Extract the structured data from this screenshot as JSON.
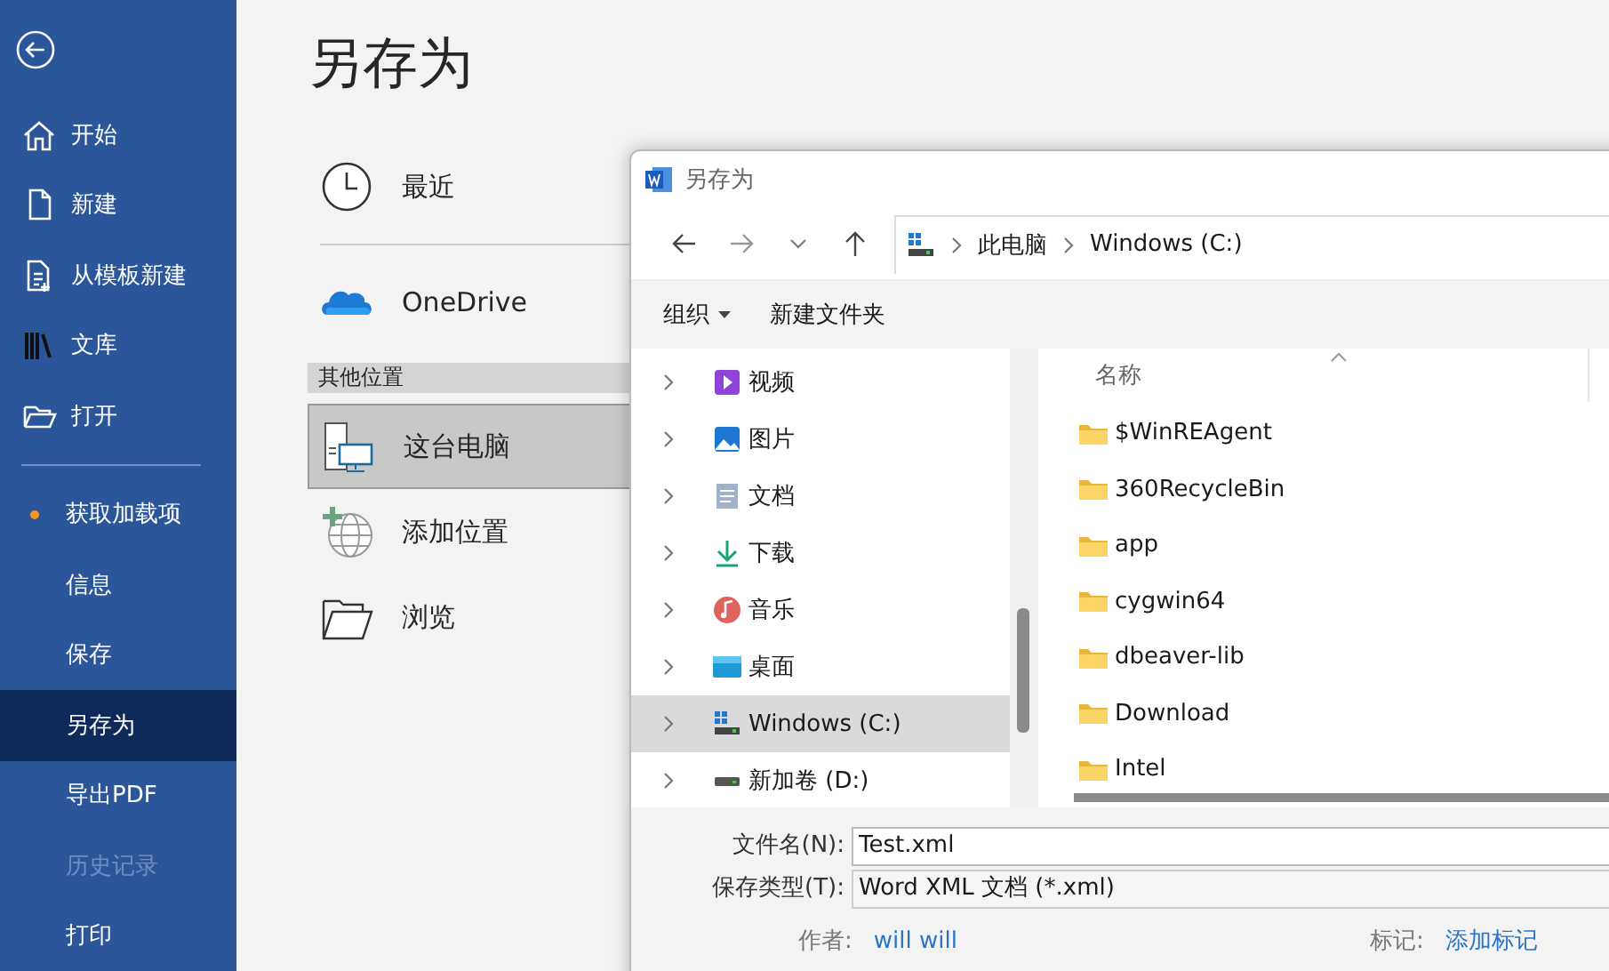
{
  "sidebar": {
    "primary": [
      {
        "label": "开始",
        "kind": "home"
      },
      {
        "label": "新建",
        "kind": "file"
      },
      {
        "label": "从模板新建",
        "kind": "template"
      },
      {
        "label": "文库",
        "kind": "library"
      },
      {
        "label": "打开",
        "kind": "folder"
      }
    ],
    "secondary": [
      {
        "label": "获取加载项",
        "selected": false,
        "disabled": false,
        "badge": true
      },
      {
        "label": "信息",
        "selected": false,
        "disabled": false,
        "badge": false
      },
      {
        "label": "保存",
        "selected": false,
        "disabled": false,
        "badge": false
      },
      {
        "label": "另存为",
        "selected": true,
        "disabled": false,
        "badge": false
      },
      {
        "label": "导出PDF",
        "selected": false,
        "disabled": false,
        "badge": false
      },
      {
        "label": "历史记录",
        "selected": false,
        "disabled": true,
        "badge": false
      },
      {
        "label": "打印",
        "selected": false,
        "disabled": false,
        "badge": false
      }
    ]
  },
  "page": {
    "title": "另存为",
    "locations": [
      {
        "label": "最近",
        "kind": "clock"
      },
      {
        "label": "OneDrive",
        "kind": "cloud"
      }
    ],
    "section": "其他位置",
    "other_locations": [
      {
        "label": "这台电脑",
        "kind": "computer",
        "selected": true
      },
      {
        "label": "添加位置",
        "kind": "globe",
        "selected": false
      },
      {
        "label": "浏览",
        "kind": "folder",
        "selected": false
      }
    ]
  },
  "dialog": {
    "title": "另存为",
    "breadcrumb": [
      "此电脑",
      "Windows (C:)"
    ],
    "toolbar": {
      "organize": "组织",
      "new_folder": "新建文件夹"
    },
    "nav_items": [
      {
        "label": "视频",
        "kind": "video",
        "selected": false
      },
      {
        "label": "图片",
        "kind": "picture",
        "selected": false
      },
      {
        "label": "文档",
        "kind": "document",
        "selected": false
      },
      {
        "label": "下载",
        "kind": "download",
        "selected": false
      },
      {
        "label": "音乐",
        "kind": "music",
        "selected": false
      },
      {
        "label": "桌面",
        "kind": "desktop",
        "selected": false
      },
      {
        "label": "Windows (C:)",
        "kind": "windrive",
        "selected": true
      },
      {
        "label": "新加卷 (D:)",
        "kind": "drive",
        "selected": false
      }
    ],
    "column": "名称",
    "files": [
      "$WinREAgent",
      "360RecycleBin",
      "app",
      "cygwin64",
      "dbeaver-lib",
      "Download",
      "Intel"
    ],
    "filename_label": "文件名(N):",
    "filename": "Test.xml",
    "type_label": "保存类型(T):",
    "type": "Word XML 文档 (*.xml)",
    "author_label": "作者:",
    "author": "will will",
    "tags_label": "标记:",
    "tags": "添加标记"
  }
}
